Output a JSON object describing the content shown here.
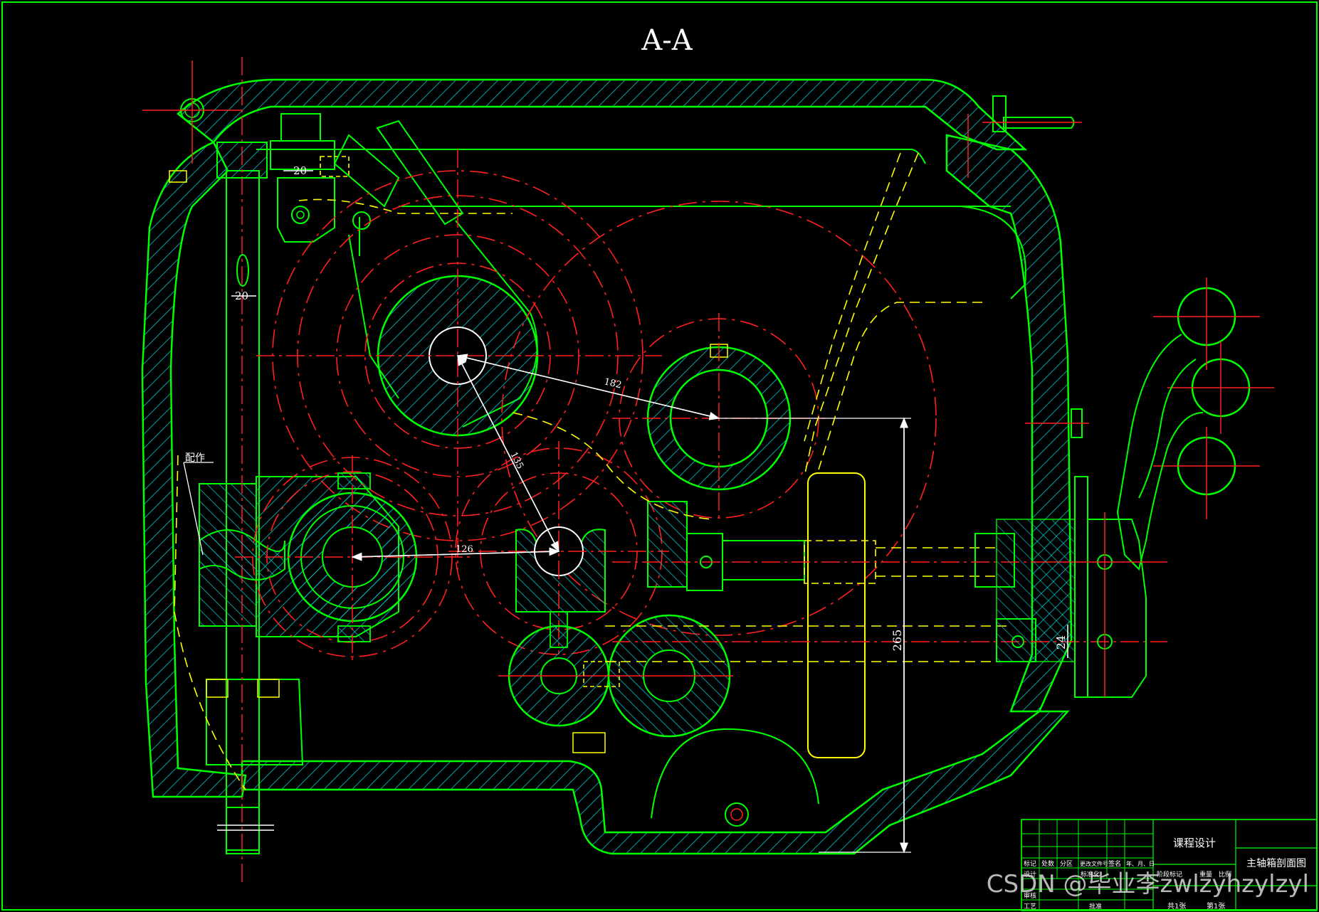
{
  "section_title": "A-A",
  "dimensions": {
    "d_top": "20",
    "d_left": "20",
    "d_182": "182",
    "d_135": "135",
    "d_126": "126",
    "d_265": "265",
    "d_24": "24"
  },
  "callout": "配作",
  "title_block": {
    "course": "课程设计",
    "drawing_name": "主轴箱剖面图",
    "header_cells": [
      "标记",
      "处数",
      "分区",
      "更改文件号",
      "签名",
      "年、月、日"
    ],
    "rows": [
      "设计",
      "标准化",
      "审核",
      "工艺",
      "批准"
    ],
    "stage_cells": [
      "阶段标记",
      "重量",
      "比例"
    ],
    "sheet_total": "共1张",
    "sheet_no": "第1张"
  },
  "watermark": "CSDN @毕业李zwlzyhzylzyl",
  "colors": {
    "outline": "#00ff00",
    "hatch": "#00cccc",
    "center": "#ff2020",
    "hidden": "#e6e600",
    "dimension": "#ffffff",
    "background": "#000000"
  }
}
